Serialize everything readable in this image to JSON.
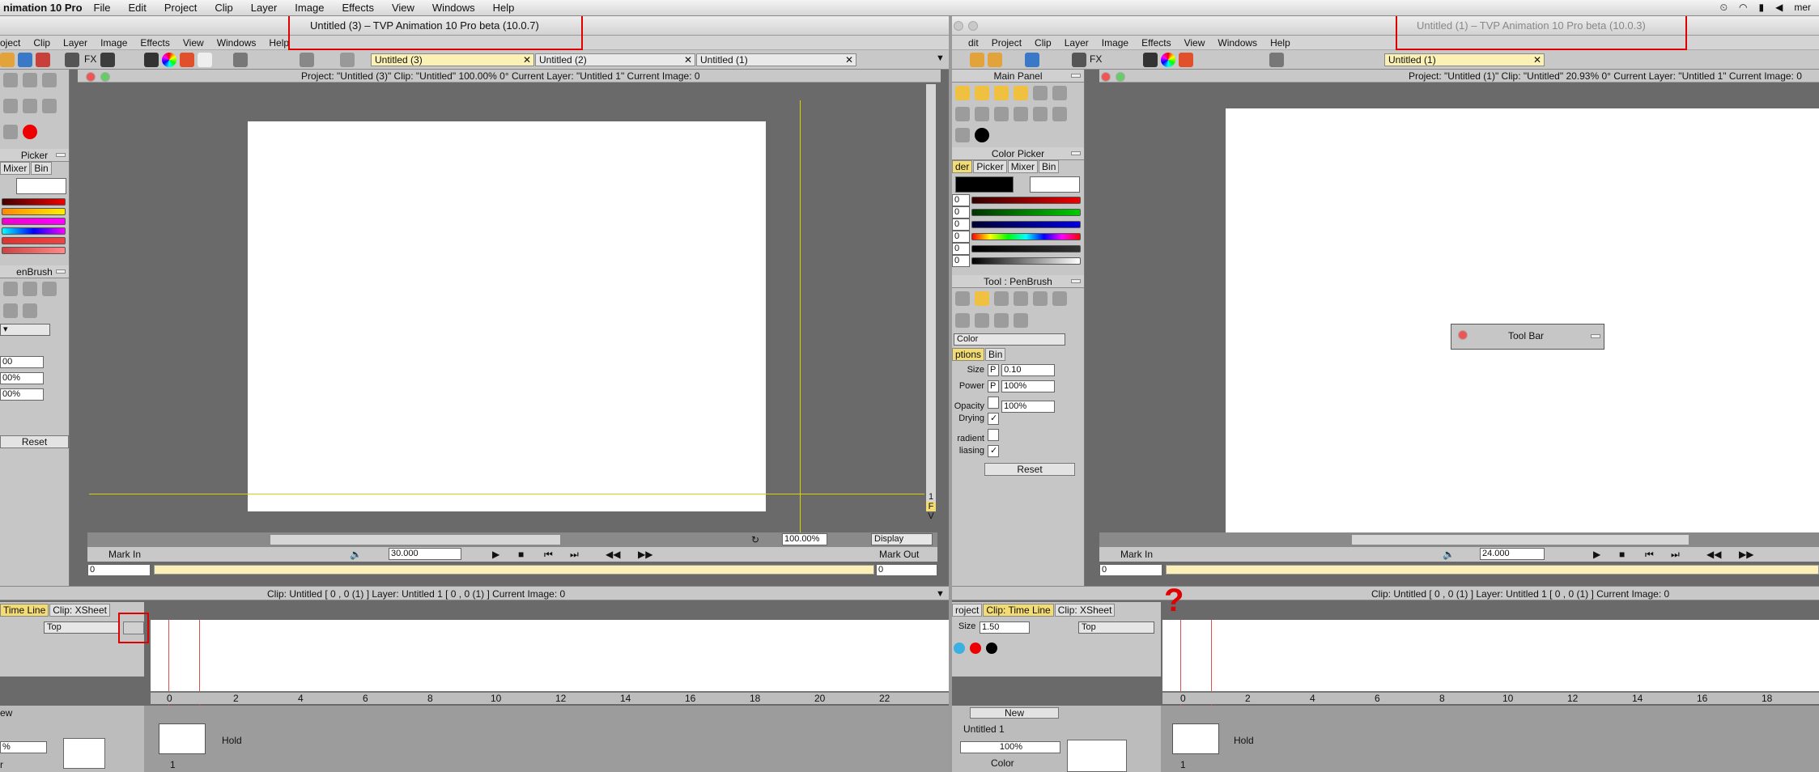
{
  "menubar": {
    "app": "nimation 10 Pro",
    "items": [
      "File",
      "Edit",
      "Project",
      "Clip",
      "Layer",
      "Image",
      "Effects",
      "View",
      "Windows",
      "Help"
    ],
    "user": "mer"
  },
  "win_left": {
    "title": "Untitled (3) – TVP Animation 10 Pro beta (10.0.7)",
    "menu": [
      "oject",
      "Clip",
      "Layer",
      "Image",
      "Effects",
      "View",
      "Windows",
      "Help"
    ],
    "fx": "FX",
    "tabs": [
      "Untitled (3)",
      "Untitled (2)",
      "Untitled (1)"
    ],
    "tab_close": "✕",
    "info": "Project: \"Untitled (3)\"  Clip: \"Untitled\"   100.00%   0°  Current Layer: \"Untitled 1\"  Current Image: 0",
    "color_picker": "Picker",
    "color_tabs": [
      "Mixer",
      "Bin"
    ],
    "tool": "enBrush",
    "fields": [
      "00",
      "00%",
      "00%"
    ],
    "reset": "Reset",
    "fps": "30.000",
    "zoom": "100.00%",
    "display": "Display",
    "side_letters": [
      "1",
      "F",
      "V"
    ],
    "mark_in": "Mark In",
    "mark_out": "Mark Out",
    "mark_in_val": "0",
    "mark_out_val": "0",
    "tl_header": "Clip: Untitled [ 0 , 0  (1) ]     Layer: Untitled 1 [ 0 , 0  (1) ]    Current Image: 0",
    "tl_tabs": [
      "Time Line",
      "Clip: XSheet"
    ],
    "top_select": "Top",
    "ruler": [
      "0",
      "2",
      "4",
      "6",
      "8",
      "10",
      "12",
      "14",
      "16",
      "18",
      "20",
      "22"
    ],
    "new_label": "ew",
    "hold": "Hold",
    "frame_num": "1",
    "pct": "%",
    "r_label": "r"
  },
  "win_right": {
    "title": "Untitled (1) – TVP Animation 10 Pro beta (10.0.3)",
    "menu": [
      "dit",
      "Project",
      "Clip",
      "Layer",
      "Image",
      "Effects",
      "View",
      "Windows",
      "Help"
    ],
    "fx": "FX",
    "tabs": [
      "Untitled (1)"
    ],
    "tab_close": "✕",
    "main_panel": "Main Panel",
    "color_picker": "Color Picker",
    "color_tabs": [
      "der",
      "Picker",
      "Mixer",
      "Bin"
    ],
    "slider_vals": [
      "0",
      "0",
      "0",
      "0",
      "0",
      "0"
    ],
    "tool": "Tool : PenBrush",
    "color_select": "Color",
    "opt_tabs": [
      "ptions",
      "Bin"
    ],
    "props": [
      {
        "label": "Size",
        "p": "P",
        "value": "0.10"
      },
      {
        "label": "Power",
        "p": "P",
        "value": "100%"
      },
      {
        "label": "Opacity",
        "p": "",
        "value": "100%"
      }
    ],
    "checks": [
      "Drying",
      "radient",
      "liasing"
    ],
    "reset": "Reset",
    "info": "Project: \"Untitled (1)\"  Clip: \"Untitled\"   20.93%   0°  Current Layer: \"Untitled 1\"  Current Image: 0",
    "toolbar_window": "Tool Bar",
    "fps": "24.000",
    "mark_in": "Mark In",
    "mark_in_val": "0",
    "tl_header": "Clip: Untitled [ 0 , 0  (1) ]     Layer: Untitled 1 [ 0 , 0  (1) ]    Current Image: 0",
    "tl_tabs": [
      "roject",
      "Clip: Time Line",
      "Clip: XSheet"
    ],
    "size_label": "Size",
    "size_val": "1.50",
    "top_select": "Top",
    "question": "?",
    "ruler": [
      "0",
      "2",
      "4",
      "6",
      "8",
      "10",
      "12",
      "14",
      "16",
      "18"
    ],
    "new_btn": "New",
    "layer_name": "Untitled 1",
    "layer_pct": "100%",
    "layer_color": "Color",
    "hold": "Hold",
    "frame_num": "1"
  }
}
